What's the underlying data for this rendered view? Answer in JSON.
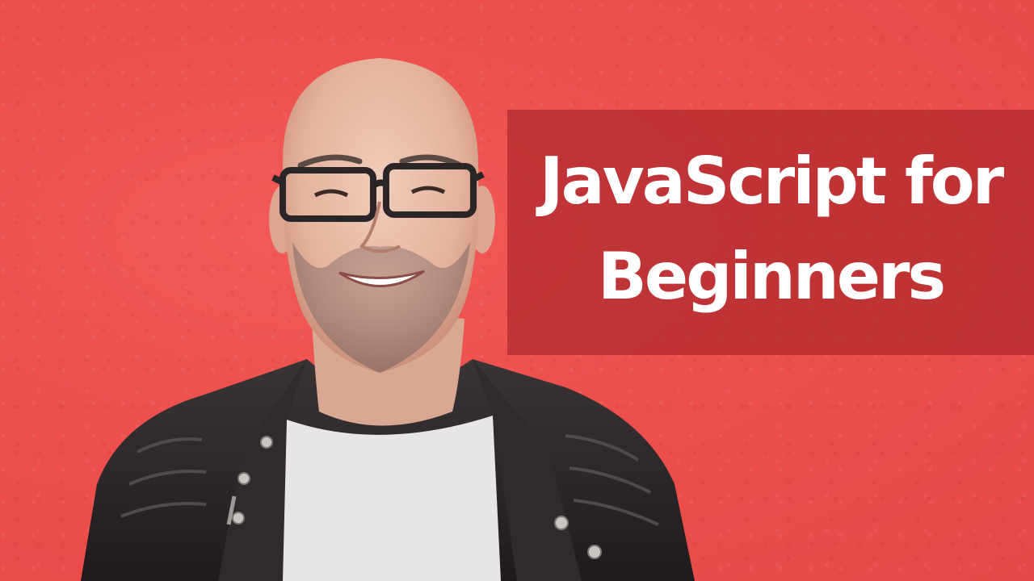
{
  "title": {
    "line1": "JavaScript for",
    "line2": "Beginners"
  },
  "colors": {
    "background": "#ee4e4c",
    "panel": "#b22c30",
    "text": "#ffffff",
    "jacket": "#2b2627",
    "shirt": "#e7e5e7",
    "skin": "#e6b9a4"
  }
}
